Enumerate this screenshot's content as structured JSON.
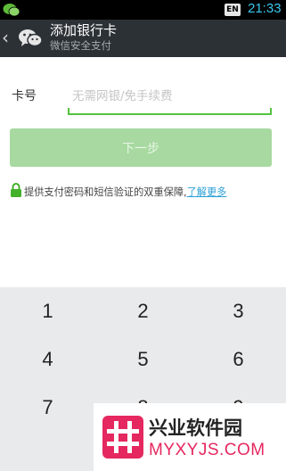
{
  "status_bar": {
    "input_method": "EN",
    "time": "21:33",
    "icons": [
      "wechat-icon"
    ]
  },
  "header": {
    "back_icon": "back-arrow-icon",
    "logo_icon": "wechat-logo-icon",
    "title": "添加银行卡",
    "subtitle": "微信安全支付"
  },
  "form": {
    "card_label": "卡号",
    "card_value": "",
    "card_placeholder": "无需网银/免手续费",
    "next_button_label": "下一步",
    "notice_text": "提供支付密码和短信验证的双重保障,",
    "learn_more_label": "了解更多",
    "lock_icon": "lock-icon"
  },
  "keypad": {
    "keys": [
      "1",
      "2",
      "3",
      "4",
      "5",
      "6",
      "7",
      "8",
      "9"
    ]
  },
  "watermark": {
    "name": "兴业软件园",
    "url": "MYXYJS.COM"
  },
  "colors": {
    "accent_green": "#53c33f",
    "button_disabled_green": "#a7d9a0",
    "title_bar": "#2c3136",
    "link_blue": "#2c9fd6",
    "clock_blue": "#3cc8ef",
    "watermark_pink": "#e5285f"
  }
}
